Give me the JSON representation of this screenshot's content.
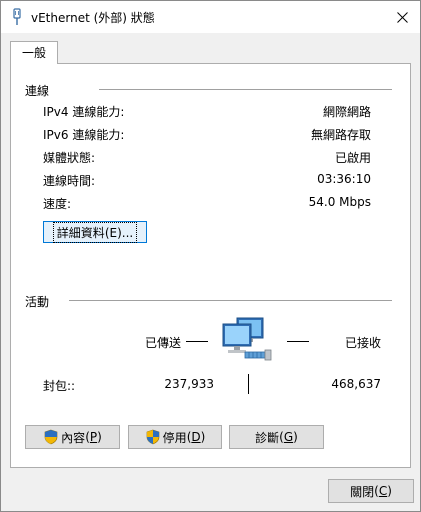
{
  "window": {
    "title": "vEthernet (外部) 狀態"
  },
  "tab": {
    "label": "一般"
  },
  "connection": {
    "section_label": "連線",
    "rows": [
      {
        "label": "IPv4 連線能力:",
        "value": "網際網路"
      },
      {
        "label": "IPv6 連線能力:",
        "value": "無網路存取"
      },
      {
        "label": "媒體狀態:",
        "value": "已啟用"
      },
      {
        "label": "連線時間:",
        "value": "03:36:10"
      },
      {
        "label": "速度:",
        "value": "54.0 Mbps"
      }
    ],
    "details_button": {
      "text": "詳細資料",
      "mnemonic": "(E)...",
      "mnemonic_key": "E"
    }
  },
  "activity": {
    "section_label": "活動",
    "sent_label": "已傳送",
    "received_label": "已接收",
    "packets_label": "封包::",
    "sent_value": "237,933",
    "received_value": "468,637"
  },
  "buttons": {
    "properties": {
      "text": "內容",
      "key": "P"
    },
    "disable": {
      "text": "停用",
      "key": "D"
    },
    "diagnose": {
      "text": "診斷",
      "key": "G"
    },
    "close": {
      "text": "關閉",
      "key": "C"
    }
  },
  "colors": {
    "accent": "#0078d7",
    "button_bg": "#e1e1e1",
    "separator": "#a0a0a0"
  }
}
